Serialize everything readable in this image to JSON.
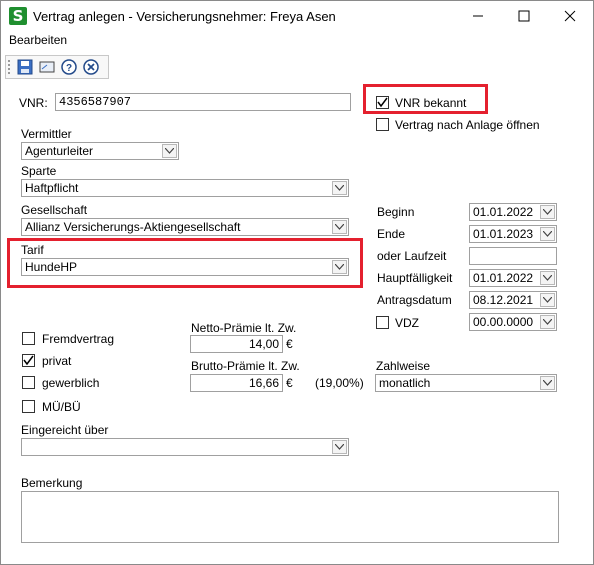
{
  "window": {
    "title": "Vertrag anlegen - Versicherungsnehmer: Freya Asen",
    "logo_letter": "S",
    "minimize_glyph": "—",
    "maximize_glyph": "☐",
    "close_glyph": "✕"
  },
  "menu": {
    "edit": "Bearbeiten"
  },
  "toolbar": {
    "icons": [
      "save-icon",
      "screen-icon",
      "help-icon",
      "cancel-icon"
    ]
  },
  "form": {
    "vnr_label": "VNR:",
    "vnr_value": "4356587907",
    "vnr_known_label": "VNR bekannt",
    "vnr_known_checked": true,
    "open_after_label": "Vertrag nach Anlage öffnen",
    "open_after_checked": false,
    "vermittler_label": "Vermittler",
    "vermittler_value": "Agenturleiter",
    "sparte_label": "Sparte",
    "sparte_value": "Haftpflicht",
    "gesellschaft_label": "Gesellschaft",
    "gesellschaft_value": "Allianz Versicherungs-Aktiengesellschaft",
    "tarif_label": "Tarif",
    "tarif_value": "HundeHP",
    "beginn_label": "Beginn",
    "beginn_value": "01.01.2022",
    "ende_label": "Ende",
    "ende_value": "01.01.2023",
    "laufzeit_label": "oder Laufzeit",
    "laufzeit_value": "",
    "hauptfaelligkeit_label": "Hauptfälligkeit",
    "hauptfaelligkeit_value": "01.01.2022",
    "antragsdatum_label": "Antragsdatum",
    "antragsdatum_value": "08.12.2021",
    "vdz_label": "VDZ",
    "vdz_value": "00.00.0000",
    "fremdvertrag_label": "Fremdvertrag",
    "privat_label": "privat",
    "gewerblich_label": "gewerblich",
    "mubu_label": "MÜ/BÜ",
    "netto_label": "Netto-Prämie lt. Zw.",
    "netto_value": "14,00",
    "brutto_label": "Brutto-Prämie lt. Zw.",
    "brutto_value": "16,66",
    "currency": "€",
    "tax_rate": "(19,00%)",
    "zahlweise_label": "Zahlweise",
    "zahlweise_value": "monatlich",
    "eingereicht_label": "Eingereicht über",
    "eingereicht_value": "",
    "bemerkung_label": "Bemerkung",
    "bemerkung_value": ""
  },
  "highlight_color": "#e4202e"
}
